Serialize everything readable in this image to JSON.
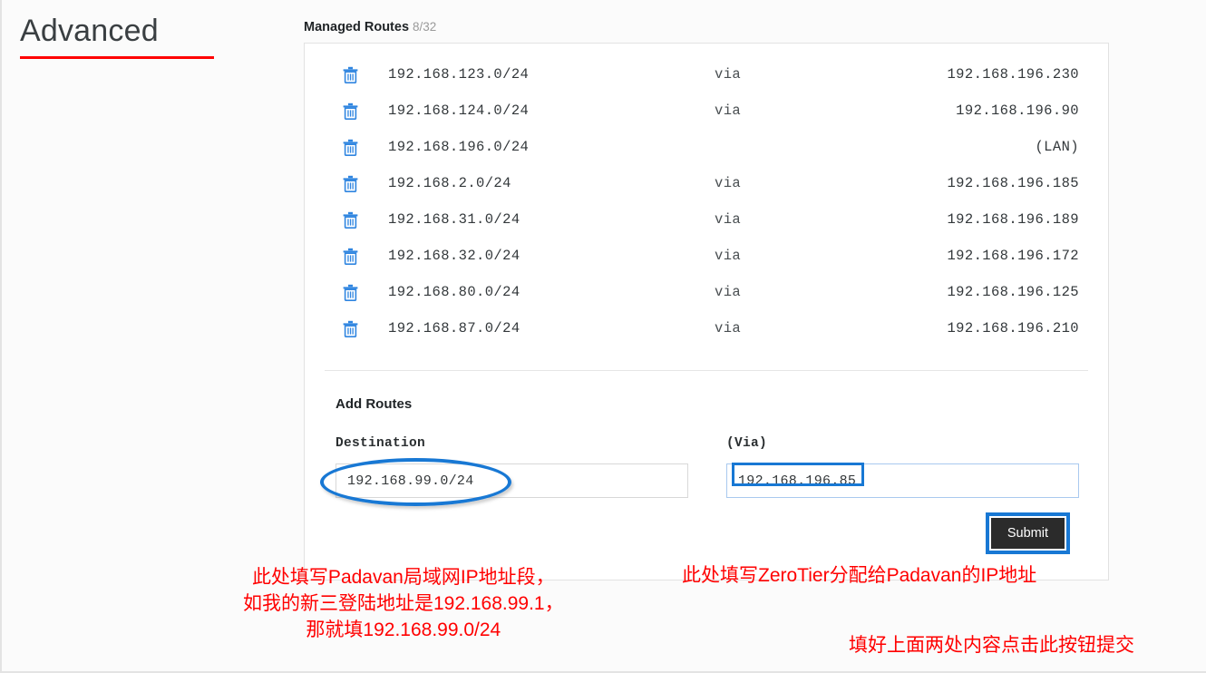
{
  "page": {
    "title": "Advanced"
  },
  "managed_routes": {
    "heading": "Managed Routes",
    "count": "8/32",
    "delete_icon": "trash-icon",
    "rows": [
      {
        "destination": "192.168.123.0/24",
        "via": "via",
        "gateway": "192.168.196.230"
      },
      {
        "destination": "192.168.124.0/24",
        "via": "via",
        "gateway": "192.168.196.90"
      },
      {
        "destination": "192.168.196.0/24",
        "via": "",
        "gateway": "(LAN)"
      },
      {
        "destination": "192.168.2.0/24",
        "via": "via",
        "gateway": "192.168.196.185"
      },
      {
        "destination": "192.168.31.0/24",
        "via": "via",
        "gateway": "192.168.196.189"
      },
      {
        "destination": "192.168.32.0/24",
        "via": "via",
        "gateway": "192.168.196.172"
      },
      {
        "destination": "192.168.80.0/24",
        "via": "via",
        "gateway": "192.168.196.125"
      },
      {
        "destination": "192.168.87.0/24",
        "via": "via",
        "gateway": "192.168.196.210"
      }
    ]
  },
  "add_routes": {
    "heading": "Add Routes",
    "destination": {
      "label": "Destination",
      "value": "192.168.99.0/24"
    },
    "via": {
      "label": "(Via)",
      "value": "192.168.196.85"
    },
    "submit_label": "Submit"
  },
  "annotations": {
    "left_line1": "此处填写Padavan局域网IP地址段，",
    "left_line2": "如我的新三登陆地址是192.168.99.1，",
    "left_line3": "那就填192.168.99.0/24",
    "right_top": "此处填写ZeroTier分配给Padavan的IP地址",
    "right_bottom": "填好上面两处内容点击此按钮提交"
  },
  "colors": {
    "accent_red": "#ff0000",
    "annot_blue": "#1878d4",
    "icon_blue": "#2f85e0",
    "button_dark": "#2b2b2b"
  }
}
